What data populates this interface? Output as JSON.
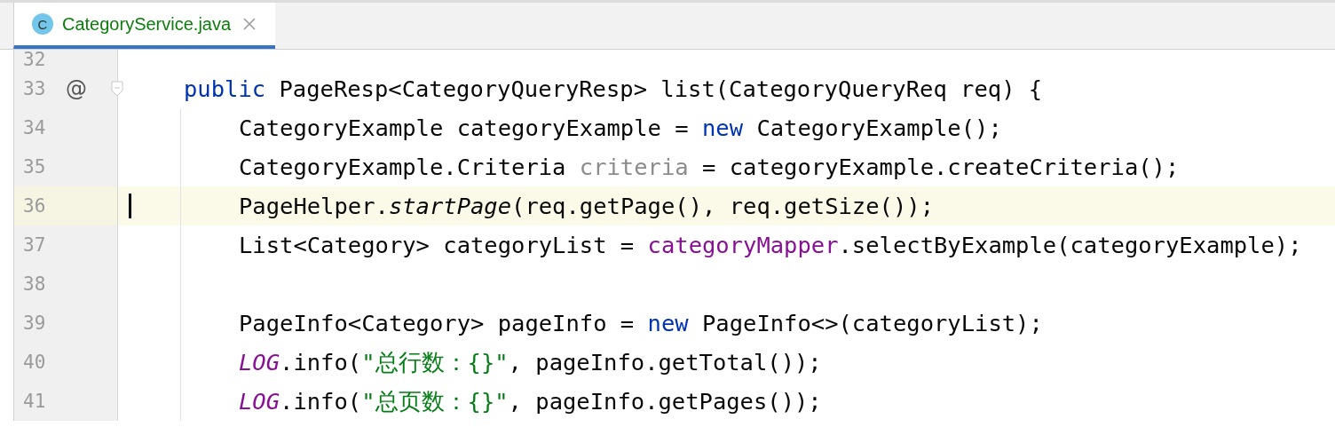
{
  "tabs": [
    {
      "icon": "C",
      "label": "CategoryService.java",
      "selected": true
    }
  ],
  "lines": [
    {
      "number": "32",
      "current": false
    },
    {
      "number": "33",
      "current": false,
      "annotation": "@",
      "foldable": true,
      "tokens": [
        {
          "kind": "keyword",
          "text": "public"
        },
        {
          "kind": "plain",
          "text": " PageResp<CategoryQueryResp> list(CategoryQueryReq req) {"
        }
      ],
      "children": [
        {
          "number": "34",
          "current": false,
          "tokens": [
            {
              "kind": "plain",
              "text": "CategoryExample categoryExample = "
            },
            {
              "kind": "keyword",
              "text": "new"
            },
            {
              "kind": "plain",
              "text": " CategoryExample();"
            }
          ]
        },
        {
          "number": "35",
          "current": false,
          "tokens": [
            {
              "kind": "plain",
              "text": "CategoryExample.Criteria "
            },
            {
              "kind": "unused",
              "text": "criteria"
            },
            {
              "kind": "plain",
              "text": " = categoryExample.createCriteria();"
            }
          ]
        },
        {
          "number": "36",
          "current": true,
          "tokens": [
            {
              "kind": "plain",
              "text": "PageHelper."
            },
            {
              "kind": "static",
              "text": "startPage"
            },
            {
              "kind": "plain",
              "text": "(req.getPage(), req.getSize());"
            }
          ]
        },
        {
          "number": "37",
          "current": false,
          "tokens": [
            {
              "kind": "plain",
              "text": "List<Category> categoryList = "
            },
            {
              "kind": "field",
              "text": "categoryMapper"
            },
            {
              "kind": "plain",
              "text": ".selectByExample(categoryExample);"
            }
          ]
        },
        {
          "number": "38",
          "current": false
        },
        {
          "number": "39",
          "current": false,
          "tokens": [
            {
              "kind": "plain",
              "text": "PageInfo<Category> pageInfo = "
            },
            {
              "kind": "keyword",
              "text": "new"
            },
            {
              "kind": "plain",
              "text": " PageInfo<>(categoryList);"
            }
          ]
        },
        {
          "number": "40",
          "current": false,
          "tokens": [
            {
              "kind": "static-field",
              "text": "LOG"
            },
            {
              "kind": "plain",
              "text": ".info("
            },
            {
              "kind": "string",
              "text": "\"总行数：{}\""
            },
            {
              "kind": "plain",
              "text": ", pageInfo.getTotal());"
            }
          ]
        },
        {
          "number": "41",
          "current": false,
          "tokens": [
            {
              "kind": "static-field",
              "text": "LOG"
            },
            {
              "kind": "plain",
              "text": ".info("
            },
            {
              "kind": "string",
              "text": "\"总页数：{}\""
            },
            {
              "kind": "plain",
              "text": ", pageInfo.getPages());"
            }
          ]
        }
      ]
    }
  ]
}
